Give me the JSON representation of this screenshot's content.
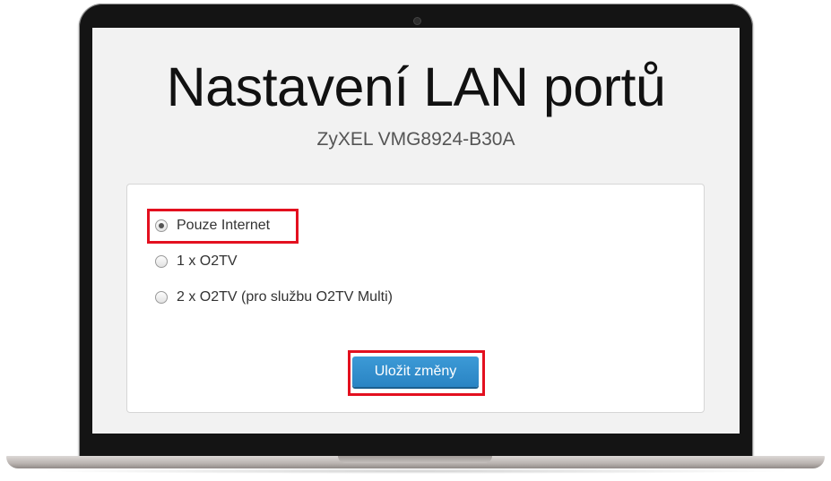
{
  "page": {
    "title": "Nastavení LAN portů",
    "subtitle": "ZyXEL VMG8924-B30A"
  },
  "lan_mode": {
    "selected": "Pouze Internet",
    "options": [
      {
        "label": "Pouze Internet",
        "checked": true,
        "highlighted": true
      },
      {
        "label": "1 x O2TV",
        "checked": false,
        "highlighted": false
      },
      {
        "label": "2 x O2TV (pro službu O2TV Multi)",
        "checked": false,
        "highlighted": false
      }
    ]
  },
  "actions": {
    "save_label": "Uložit změny",
    "save_highlighted": true
  },
  "colors": {
    "highlight": "#e3101f",
    "button": "#2f8cce",
    "screen_background": "#f2f2f2"
  }
}
